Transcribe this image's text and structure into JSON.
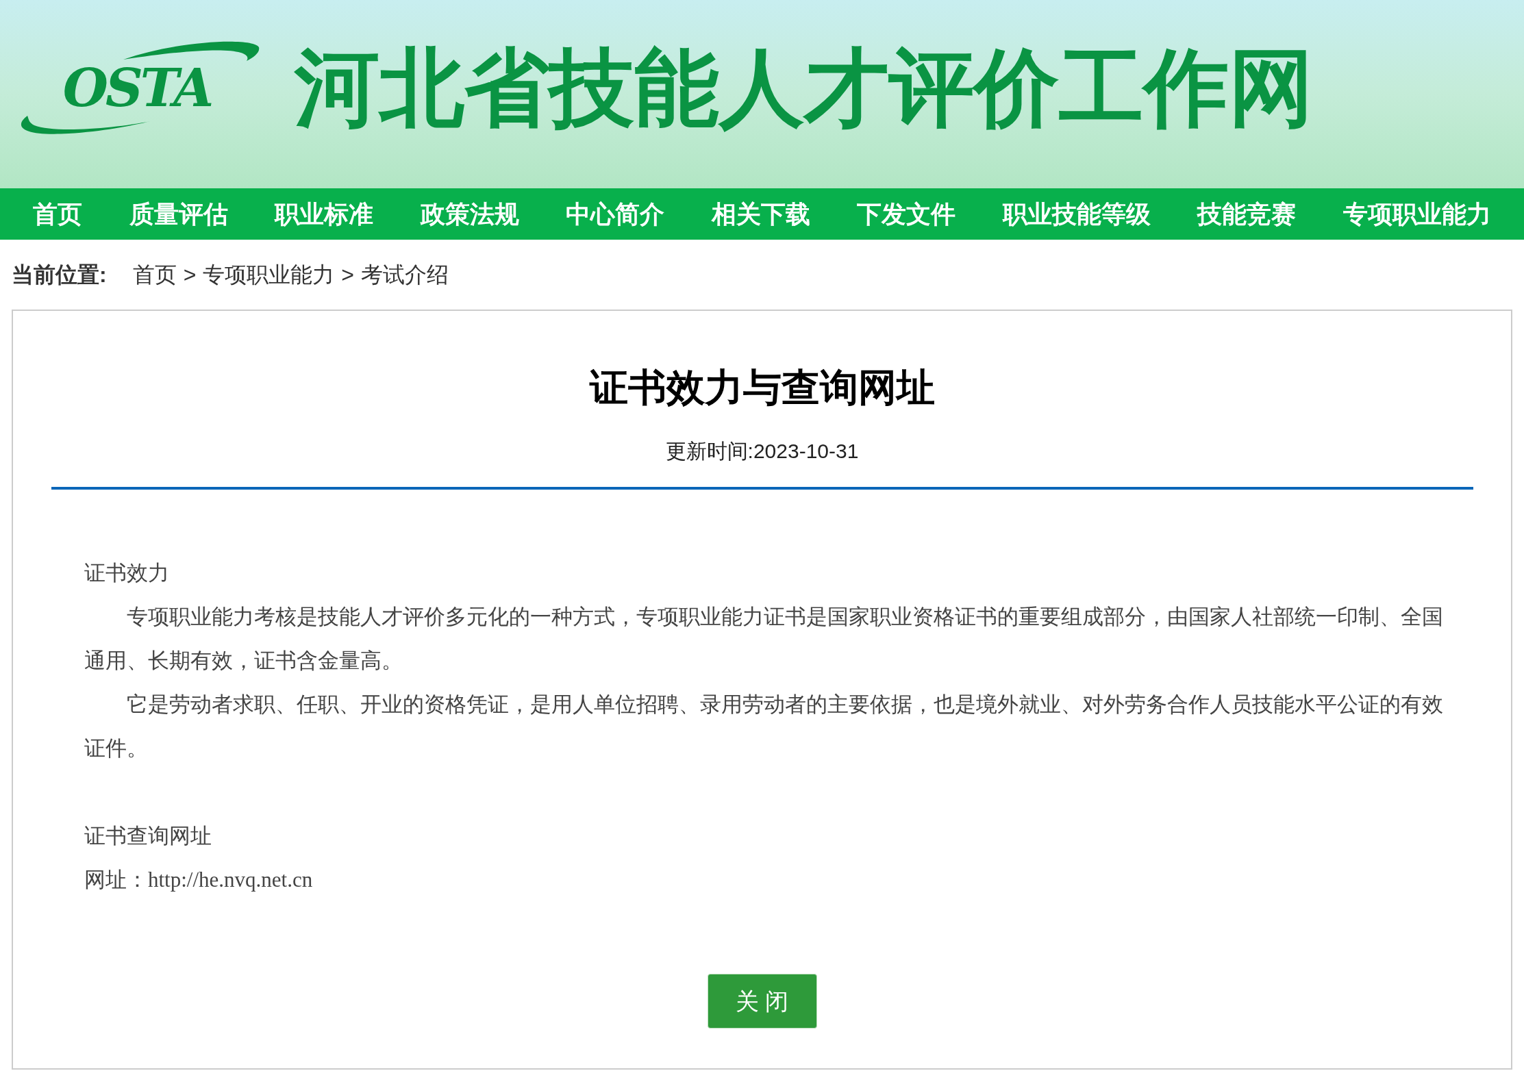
{
  "header": {
    "logo_text": "OSTA",
    "site_title": "河北省技能人才评价工作网"
  },
  "nav": [
    {
      "label": "首页"
    },
    {
      "label": "质量评估"
    },
    {
      "label": "职业标准"
    },
    {
      "label": "政策法规"
    },
    {
      "label": "中心简介"
    },
    {
      "label": "相关下载"
    },
    {
      "label": "下发文件"
    },
    {
      "label": "职业技能等级"
    },
    {
      "label": "技能竞赛"
    },
    {
      "label": "专项职业能力"
    }
  ],
  "breadcrumb": {
    "label": "当前位置:",
    "items": [
      "首页",
      "专项职业能力",
      "考试介绍"
    ],
    "separator": ">"
  },
  "article": {
    "title": "证书效力与查询网址",
    "updated": "更新时间:2023-10-31",
    "blocks": [
      {
        "kind": "heading",
        "text": "证书效力"
      },
      {
        "kind": "paragraph",
        "text": "专项职业能力考核是技能人才评价多元化的一种方式，专项职业能力证书是国家职业资格证书的重要组成部分，由国家人社部统一印制、全国通用、长期有效，证书含金量高。"
      },
      {
        "kind": "paragraph",
        "text": "它是劳动者求职、任职、开业的资格凭证，是用人单位招聘、录用劳动者的主要依据，也是境外就业、对外劳务合作人员技能水平公证的有效证件。"
      },
      {
        "kind": "spacer"
      },
      {
        "kind": "heading",
        "text": "证书查询网址"
      },
      {
        "kind": "heading",
        "text": "网址：http://he.nvq.net.cn"
      }
    ],
    "close_button": "关 闭"
  }
}
